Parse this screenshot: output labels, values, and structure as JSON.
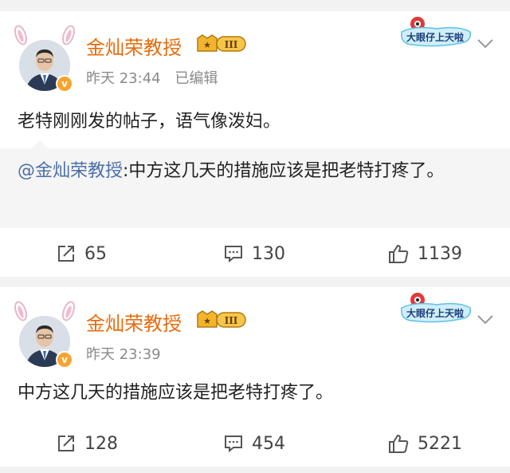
{
  "posts": [
    {
      "author": "金灿荣教授",
      "time": "昨天 23:44",
      "edited": "已编辑",
      "text": "老特刚刚发的帖子，语气像泼妇。",
      "repost": {
        "mention": "@金灿荣教授",
        "text": ":中方这几天的措施应该是把老特打疼了。"
      },
      "shares": "65",
      "comments": "130",
      "likes": "1139"
    },
    {
      "author": "金灿荣教授",
      "time": "昨天 23:39",
      "text": "中方这几天的措施应该是把老特打疼了。",
      "shares": "128",
      "comments": "454",
      "likes": "5221"
    }
  ],
  "level_badge": "III",
  "verified_badge": "v",
  "sticker_text": "大眼仔上天啦",
  "colors": {
    "author_name": "#e86b0c",
    "mention": "#4a6fa8",
    "repost_bg": "#f5f5f5",
    "verified": "#f7a32d"
  }
}
